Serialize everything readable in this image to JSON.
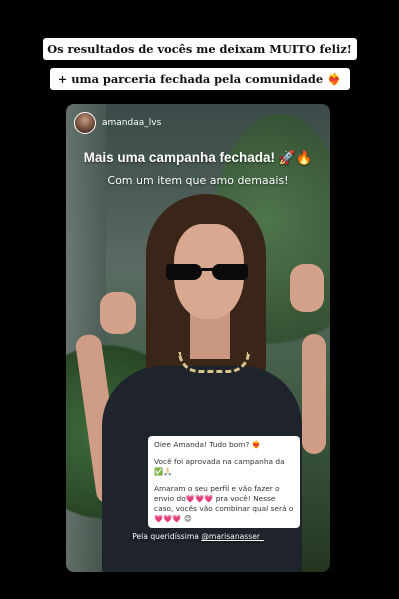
{
  "captions": {
    "line1": "Os resultados de vocês me deixam MUITO feliz!",
    "line2": "+ uma parceria fechada pela comunidade ❤️‍🔥"
  },
  "story": {
    "username": "amandaa_lvs",
    "headline": "Mais uma campanha fechada! 🚀🔥",
    "subline": "Com um item que amo demaais!",
    "dm_message": {
      "line1": "Oiee Amanda! Tudo bom? ❤️‍🔥",
      "line2": "Você foi aprovada na campanha da ✅🙏🏻",
      "line3": "Amaram o seu perfil e vão fazer o envio do💗💗💗 pra você! Nesse caso, vocês vão combinar qual será o💗💗💗 😊"
    },
    "credit_prefix": "Pela queridíssima ",
    "credit_handle": "@marisanasser_"
  }
}
